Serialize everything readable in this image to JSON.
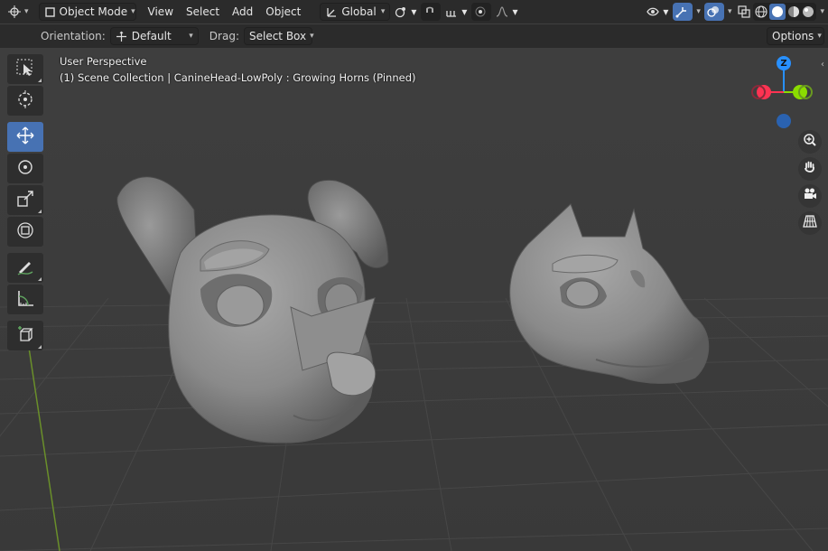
{
  "header": {
    "editor_type_icon": "3d-viewport-icon",
    "mode_label": "Object Mode",
    "menus": [
      "View",
      "Select",
      "Add",
      "Object"
    ],
    "transform_orientation": "Global",
    "pivot_icon": "pivot-point-icon",
    "snap_icon": "snap-icon",
    "proportional_icon": "proportional-editing-icon"
  },
  "tool_settings": {
    "orientation_label": "Orientation:",
    "orientation_value": "Default",
    "drag_label": "Drag:",
    "drag_value": "Select Box",
    "options_label": "Options"
  },
  "toolbar": {
    "tools": [
      {
        "name": "select-box-tool",
        "icon": "select-box-icon",
        "active": false
      },
      {
        "name": "cursor-tool",
        "icon": "cursor-icon",
        "active": false
      },
      {
        "name": "move-tool",
        "icon": "move-icon",
        "active": true
      },
      {
        "name": "rotate-tool",
        "icon": "rotate-icon",
        "active": false
      },
      {
        "name": "scale-tool",
        "icon": "scale-icon",
        "active": false
      },
      {
        "name": "transform-tool",
        "icon": "transform-icon",
        "active": false
      },
      {
        "name": "annotate-tool",
        "icon": "annotate-icon",
        "active": false
      },
      {
        "name": "measure-tool",
        "icon": "measure-icon",
        "active": false
      },
      {
        "name": "add-cube-tool",
        "icon": "add-cube-icon",
        "active": false
      }
    ]
  },
  "viewport": {
    "perspective_label": "User Perspective",
    "collection_label": "(1) Scene Collection | CanineHead-LowPoly : Growing Horns (Pinned)",
    "gizmo": {
      "z_label": "Z",
      "x_color": "#ff3352",
      "y_color": "#8bdc00",
      "z_color": "#2890ff"
    }
  },
  "colors": {
    "header_bg": "#2b2b2b",
    "viewport_bg": "#3d3d3d",
    "accent": "#4772b3"
  }
}
